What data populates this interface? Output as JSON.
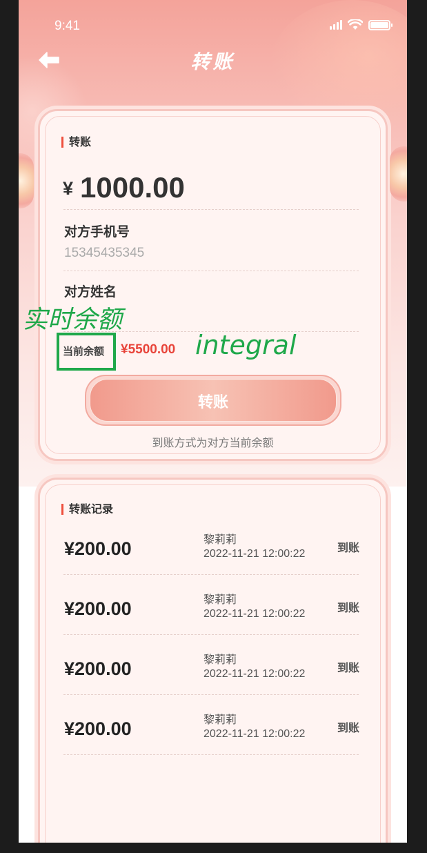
{
  "status_bar": {
    "time": "9:41"
  },
  "nav": {
    "title": "转账"
  },
  "transfer_card": {
    "section_title": "转账",
    "currency": "¥",
    "amount": "1000.00",
    "phone_label": "对方手机号",
    "phone_value": "15345435345",
    "name_label": "对方姓名",
    "balance_label": "当前余额",
    "balance_value": "¥5500.00",
    "button_label": "转账",
    "note": "到账方式为对方当前余额"
  },
  "annotations": {
    "realtime_balance": "实时余额",
    "integral": "integral",
    "color": "#1fa84a"
  },
  "records": {
    "section_title": "转账记录",
    "items": [
      {
        "amount": "¥200.00",
        "name": "黎莉莉",
        "time": "2022-11-21 12:00:22",
        "status": "到账"
      },
      {
        "amount": "¥200.00",
        "name": "黎莉莉",
        "time": "2022-11-21 12:00:22",
        "status": "到账"
      },
      {
        "amount": "¥200.00",
        "name": "黎莉莉",
        "time": "2022-11-21 12:00:22",
        "status": "到账"
      },
      {
        "amount": "¥200.00",
        "name": "黎莉莉",
        "time": "2022-11-21 12:00:22",
        "status": "到账"
      }
    ]
  },
  "colors": {
    "accent": "#ee4f3d",
    "balance": "#e8443a",
    "header_gradient_top": "#f4a39a"
  }
}
